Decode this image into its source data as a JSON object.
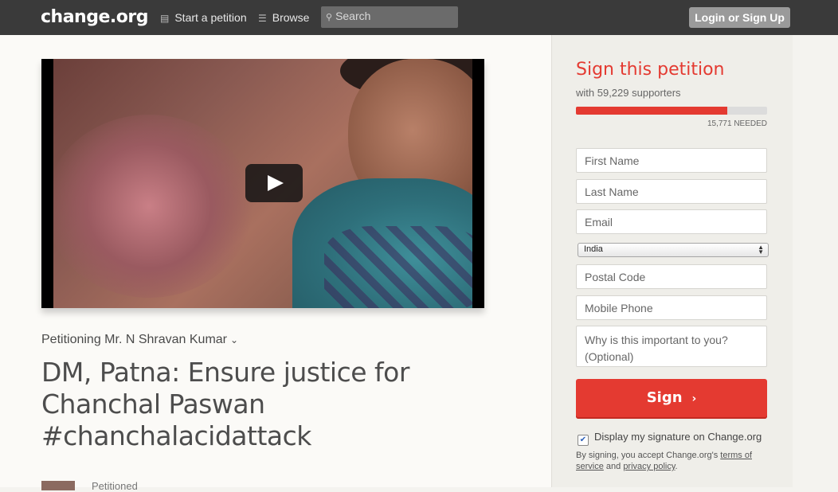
{
  "header": {
    "logo": "change.org",
    "nav": [
      {
        "label": "Start a petition",
        "icon": "document-icon"
      },
      {
        "label": "Browse",
        "icon": "list-icon"
      }
    ],
    "search_placeholder": "Search",
    "login_label": "Login or Sign Up"
  },
  "petition": {
    "petitioning": "Petitioning Mr. N Shravan Kumar",
    "title": "DM, Patna: Ensure justice for Chanchal Paswan #chanchalacidattack",
    "petition_by_label": "Petitioned"
  },
  "sign_panel": {
    "title": "Sign this petition",
    "supporters": "with 59,229 supporters",
    "progress_fraction": 0.79,
    "needed": "15,771 NEEDED",
    "fields": {
      "first_name": "First Name",
      "last_name": "Last Name",
      "email": "Email",
      "country": "India",
      "postal_code": "Postal Code",
      "mobile_phone": "Mobile Phone",
      "reason": "Why is this important to you? (Optional)"
    },
    "sign_button": "Sign",
    "display_signature": "Display my signature on Change.org",
    "terms_prefix": "By signing, you accept Change.org's ",
    "terms_link": "terms of service",
    "terms_and": " and ",
    "privacy_link": "privacy policy",
    "terms_suffix": "."
  },
  "colors": {
    "accent": "#e43a31",
    "topbar": "#3a3a3a"
  }
}
